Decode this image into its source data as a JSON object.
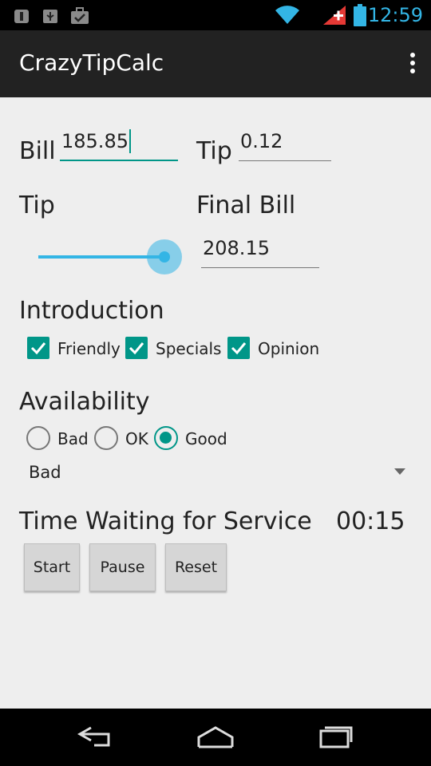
{
  "status_bar": {
    "time": "12:59",
    "icons": [
      "android-debug-icon",
      "usb-icon",
      "briefcase-check-icon",
      "wifi-icon",
      "signal-alert-icon",
      "battery-icon"
    ]
  },
  "app": {
    "title": "CrazyTipCalc"
  },
  "bill": {
    "label": "Bill",
    "value": "185.85"
  },
  "tip_rate": {
    "label": "Tip",
    "value": "0.12"
  },
  "tip_section": {
    "label": "Tip",
    "slider_fraction": 0.88
  },
  "final_bill": {
    "label": "Final Bill",
    "value": "208.15"
  },
  "introduction": {
    "label": "Introduction",
    "options": [
      {
        "label": "Friendly",
        "checked": true
      },
      {
        "label": "Specials",
        "checked": true
      },
      {
        "label": "Opinion",
        "checked": true
      }
    ]
  },
  "availability": {
    "label": "Availability",
    "options": [
      {
        "label": "Bad",
        "checked": false
      },
      {
        "label": "OK",
        "checked": false
      },
      {
        "label": "Good",
        "checked": true
      }
    ],
    "spinner_value": "Bad"
  },
  "timer": {
    "label": "Time Waiting for Service",
    "value": "00:15",
    "buttons": {
      "start": "Start",
      "pause": "Pause",
      "reset": "Reset"
    }
  },
  "colors": {
    "accent": "#009688",
    "holo_blue": "#33b5e5",
    "action_bar": "#222222",
    "background": "#eeeeee"
  }
}
